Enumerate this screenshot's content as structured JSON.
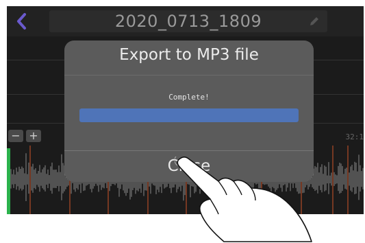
{
  "header": {
    "title": "2020_0713_1809"
  },
  "icons": {
    "back": "chevron-left-icon",
    "edit": "pencil-icon",
    "zoom_out": "minus-icon",
    "zoom_in": "plus-icon",
    "gesture": "pointing-hand-icon"
  },
  "zoom": {
    "minus_label": "−",
    "plus_label": "+",
    "level": "32:1"
  },
  "dialog": {
    "title": "Export to MP3 file",
    "status": "Complete!",
    "progress": 1.0,
    "close_label": "Close"
  },
  "colors": {
    "accent": "#6a5acd",
    "progress": "#4f74b8",
    "level_meter": "#2bb24c",
    "marker": "#d1552a"
  }
}
